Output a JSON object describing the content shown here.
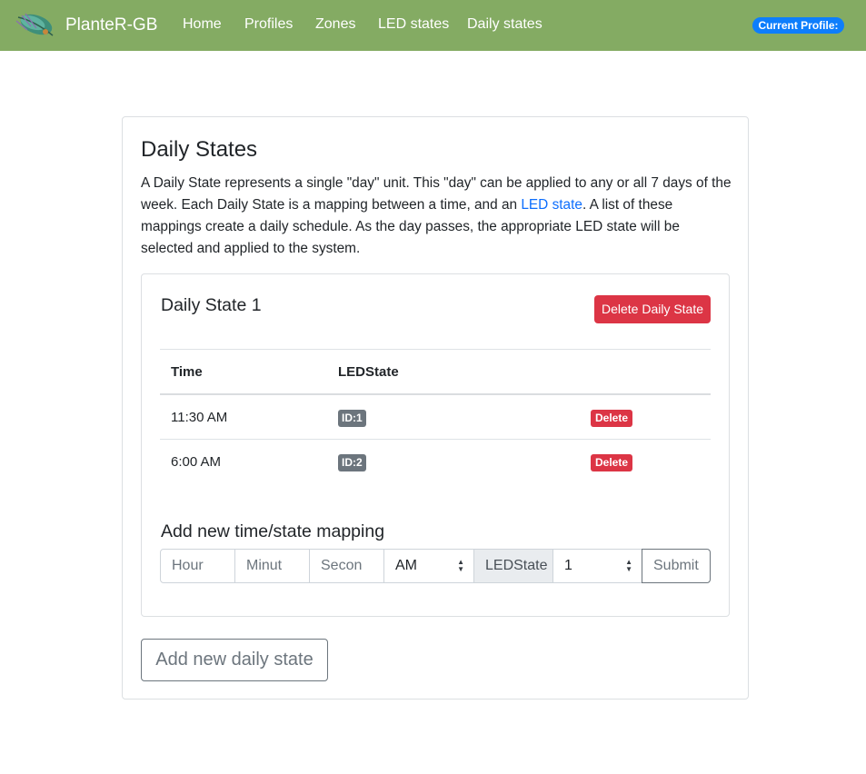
{
  "navbar": {
    "brand": "PlanteR-GB",
    "logo_icon": "leaf-logo-icon",
    "links": [
      "Home",
      "Profiles",
      "Zones",
      "LED states",
      "Daily states"
    ],
    "profile_badge": "Current Profile:",
    "background_color": "#84ab63"
  },
  "page": {
    "title": "Daily States",
    "description_before": "A Daily State represents a single \"day\" unit. This \"day\" can be applied to any or all 7 days of the week. Each Daily State is a mapping between a time, and an ",
    "description_link": "LED state",
    "description_after": ". A list of these mappings create a daily schedule. As the day passes, the appropriate LED state will be selected and applied to the system."
  },
  "daily_state": {
    "title": "Daily State 1",
    "delete_label": "Delete Daily State",
    "columns": [
      "Time",
      "LEDState"
    ],
    "rows": [
      {
        "time": "11:30 AM",
        "led_state": "ID:1",
        "delete": "Delete"
      },
      {
        "time": "6:00 AM",
        "led_state": "ID:2",
        "delete": "Delete"
      }
    ],
    "add_title": "Add new time/state mapping",
    "form": {
      "hour_placeholder": "Hour",
      "minute_placeholder": "Minut",
      "second_placeholder": "Secon",
      "ampm_value": "AM",
      "ledstate_label": "LEDState",
      "ledstate_value": "1",
      "submit_label": "Submit"
    }
  },
  "add_daily_state_label": "Add new daily state",
  "colors": {
    "danger": "#dc3545",
    "secondary": "#6c757d",
    "primary": "#0d6efd"
  }
}
